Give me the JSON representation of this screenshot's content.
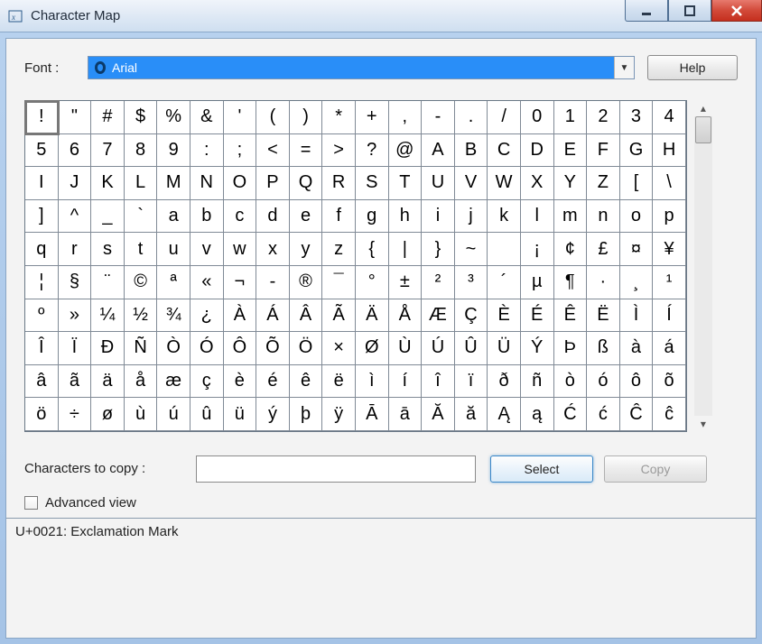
{
  "window": {
    "title": "Character Map"
  },
  "font": {
    "label": "Font :",
    "selected": "Arial",
    "help_label": "Help"
  },
  "grid": {
    "columns": 20,
    "selected_index": 0,
    "chars": [
      "!",
      "\"",
      "#",
      "$",
      "%",
      "&",
      "'",
      "(",
      ")",
      "*",
      "+",
      ",",
      "-",
      ".",
      "/",
      "0",
      "1",
      "2",
      "3",
      "4",
      "5",
      "6",
      "7",
      "8",
      "9",
      ":",
      ";",
      "<",
      "=",
      ">",
      "?",
      "@",
      "A",
      "B",
      "C",
      "D",
      "E",
      "F",
      "G",
      "H",
      "I",
      "J",
      "K",
      "L",
      "M",
      "N",
      "O",
      "P",
      "Q",
      "R",
      "S",
      "T",
      "U",
      "V",
      "W",
      "X",
      "Y",
      "Z",
      "[",
      "\\",
      "]",
      "^",
      "_",
      "`",
      "a",
      "b",
      "c",
      "d",
      "e",
      "f",
      "g",
      "h",
      "i",
      "j",
      "k",
      "l",
      "m",
      "n",
      "o",
      "p",
      "q",
      "r",
      "s",
      "t",
      "u",
      "v",
      "w",
      "x",
      "y",
      "z",
      "{",
      "|",
      "}",
      "~",
      " ",
      "¡",
      "¢",
      "£",
      "¤",
      "¥",
      "¦",
      "§",
      "¨",
      "©",
      "ª",
      "«",
      "¬",
      "-",
      "®",
      "¯",
      "°",
      "±",
      "²",
      "³",
      "´",
      "µ",
      "¶",
      "·",
      "¸",
      "¹",
      "º",
      "»",
      "¼",
      "½",
      "¾",
      "¿",
      "À",
      "Á",
      "Â",
      "Ã",
      "Ä",
      "Å",
      "Æ",
      "Ç",
      "È",
      "É",
      "Ê",
      "Ë",
      "Ì",
      "Í",
      "Î",
      "Ï",
      "Đ",
      "Ñ",
      "Ò",
      "Ó",
      "Ô",
      "Õ",
      "Ö",
      "×",
      "Ø",
      "Ù",
      "Ú",
      "Û",
      "Ü",
      "Ý",
      "Þ",
      "ß",
      "à",
      "á",
      "â",
      "ã",
      "ä",
      "å",
      "æ",
      "ç",
      "è",
      "é",
      "ê",
      "ë",
      "ì",
      "í",
      "î",
      "ï",
      "ð",
      "ñ",
      "ò",
      "ó",
      "ô",
      "õ",
      "ö",
      "÷",
      "ø",
      "ù",
      "ú",
      "û",
      "ü",
      "ý",
      "þ",
      "ÿ",
      "Ā",
      "ā",
      "Ă",
      "ă",
      "Ą",
      "ą",
      "Ć",
      "ć",
      "Ĉ",
      "ĉ"
    ]
  },
  "copy": {
    "label": "Characters to copy :",
    "value": "",
    "select_label": "Select",
    "copy_label": "Copy"
  },
  "advanced": {
    "label": "Advanced view",
    "checked": false
  },
  "status": {
    "text": "U+0021: Exclamation Mark"
  }
}
